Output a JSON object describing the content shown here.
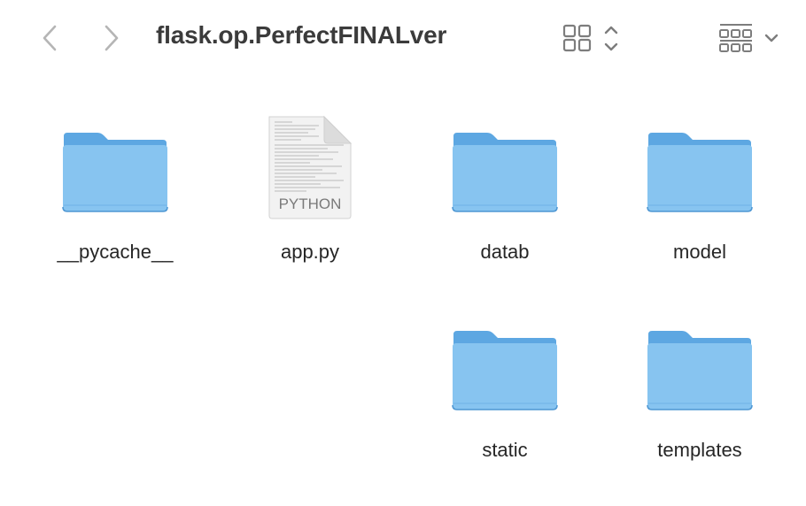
{
  "window": {
    "title": "flask.op.PerfectFINALver"
  },
  "toolbar": {
    "back_icon": "chevron-left-icon",
    "forward_icon": "chevron-right-icon",
    "view_icon": "icon-grid-view-icon",
    "group_icon": "group-by-icon"
  },
  "items": [
    {
      "name": "__pycache__",
      "kind": "folder"
    },
    {
      "name": "app.py",
      "kind": "python-document",
      "badge": "PYTHON"
    },
    {
      "name": "datab",
      "kind": "folder"
    },
    {
      "name": "model",
      "kind": "folder"
    },
    {
      "name": "static",
      "kind": "folder"
    },
    {
      "name": "templates",
      "kind": "folder"
    }
  ],
  "colors": {
    "folder_front": "#87C4F0",
    "folder_back": "#5DA7E2",
    "folder_edge": "#4E97D3",
    "icon_gray": "#8a8a8a"
  }
}
